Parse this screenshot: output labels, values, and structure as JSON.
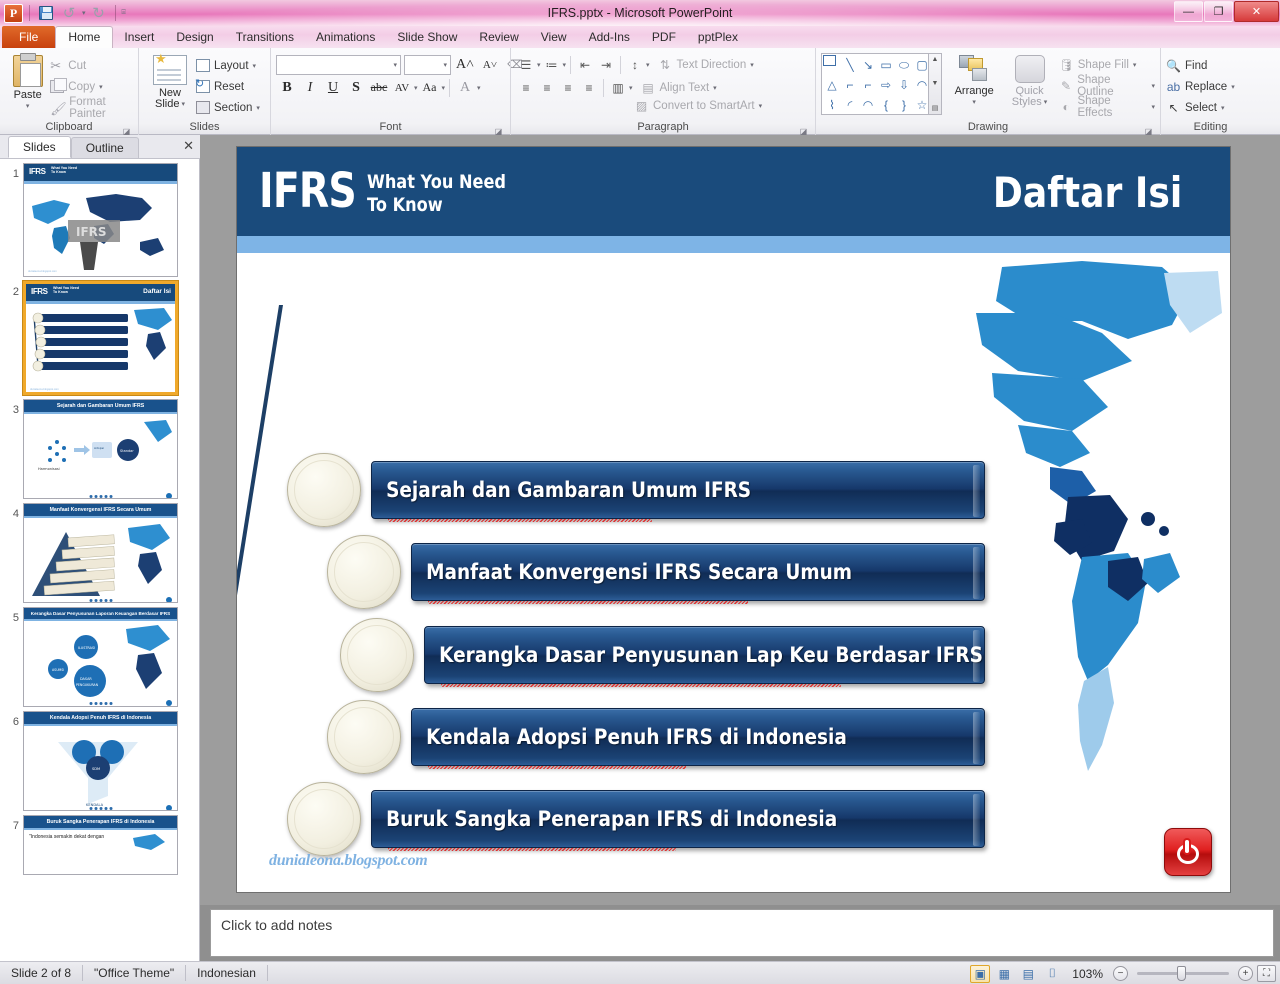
{
  "window": {
    "title": "IFRS.pptx  -  Microsoft PowerPoint",
    "app_icon": "powerpoint-icon",
    "minimize": "—",
    "maximize": "❐",
    "close": "✕"
  },
  "quick_access": [
    {
      "name": "save",
      "glyph": "save-icon"
    },
    {
      "name": "undo",
      "glyph": "↺"
    },
    {
      "name": "redo",
      "glyph": "↻"
    },
    {
      "name": "customize",
      "glyph": "▾"
    }
  ],
  "ribbon_tabs": [
    {
      "label": "File",
      "type": "file"
    },
    {
      "label": "Home",
      "type": "active"
    },
    {
      "label": "Insert",
      "type": "normal"
    },
    {
      "label": "Design",
      "type": "normal"
    },
    {
      "label": "Transitions",
      "type": "normal"
    },
    {
      "label": "Animations",
      "type": "normal"
    },
    {
      "label": "Slide Show",
      "type": "normal"
    },
    {
      "label": "Review",
      "type": "normal"
    },
    {
      "label": "View",
      "type": "normal"
    },
    {
      "label": "Add-Ins",
      "type": "normal"
    },
    {
      "label": "PDF",
      "type": "normal"
    },
    {
      "label": "pptPlex",
      "type": "normal"
    }
  ],
  "ribbon": {
    "clipboard": {
      "label": "Clipboard",
      "paste": "Paste",
      "cut": "Cut",
      "copy": "Copy",
      "format_painter": "Format Painter"
    },
    "slides": {
      "label": "Slides",
      "new_slide": "New\nSlide",
      "new_slide_line1": "New",
      "new_slide_line2": "Slide",
      "layout": "Layout",
      "reset": "Reset",
      "section": "Section"
    },
    "font": {
      "label": "Font",
      "font_name": "",
      "font_size": "",
      "bold": "B",
      "italic": "I",
      "underline": "U",
      "shadow": "S",
      "strikethrough": "abc",
      "spacing": "AV",
      "change_case": "Aa",
      "font_color": "A",
      "clear_formatting": "clear-formatting-icon"
    },
    "paragraph": {
      "label": "Paragraph",
      "text_direction": "Text Direction",
      "align_text": "Align Text",
      "convert_smartart": "Convert to SmartArt"
    },
    "drawing": {
      "label": "Drawing",
      "arrange": "Arrange",
      "quick_styles_line1": "Quick",
      "quick_styles_line2": "Styles",
      "shape_fill": "Shape Fill",
      "shape_outline": "Shape Outline",
      "shape_effects": "Shape Effects",
      "shapes": [
        "▤",
        "╲",
        "↘",
        "▭",
        "⬭",
        "▢",
        "△",
        "⌐",
        "⌐",
        "⇨",
        "⇩",
        "◠",
        "⌇",
        "◡",
        "◠",
        "{",
        "}",
        "☆"
      ]
    },
    "editing": {
      "label": "Editing",
      "find": "Find",
      "replace": "Replace",
      "select": "Select"
    }
  },
  "panel": {
    "tab_slides": "Slides",
    "tab_outline": "Outline",
    "close": "✕",
    "thumbnails": [
      {
        "number": "1",
        "type": "title",
        "title": "",
        "selected": false
      },
      {
        "number": "2",
        "type": "toc",
        "title": "Daftar Isi",
        "selected": true
      },
      {
        "number": "3",
        "type": "content",
        "title": "Sejarah dan Gambaran Umum IFRS",
        "selected": false
      },
      {
        "number": "4",
        "type": "content",
        "title": "Manfaat Konvergensi IFRS Secara Umum",
        "selected": false
      },
      {
        "number": "5",
        "type": "content",
        "title": "Kerangka Dasar Penyusunan Laporan Keuangan Berdasar IFRS",
        "selected": false
      },
      {
        "number": "6",
        "type": "content",
        "title": "Kendala Adopsi Penuh IFRS di Indonesia",
        "selected": false
      },
      {
        "number": "7",
        "type": "content",
        "title": "Buruk Sangka Penerapan IFRS di Indonesia",
        "selected": false,
        "body": "\"Indonesia semakin dekat dengan"
      }
    ]
  },
  "slide": {
    "brand": "IFRS",
    "brand_sub_line1": "What You Need",
    "brand_sub_line2": "To Know",
    "title": "Daftar Isi",
    "items": [
      {
        "text": "Sejarah dan Gambaran Umum IFRS",
        "misspelled_width": 210
      },
      {
        "text": "Manfaat Konvergensi IFRS Secara Umum",
        "misspelled_width": 255
      },
      {
        "text": "Kerangka Dasar  Penyusunan Lap Keu Berdasar IFRS",
        "misspelled_width": 330
      },
      {
        "text": "Kendala Adopsi  Penuh IFRS di Indonesia",
        "misspelled_width": 200
      },
      {
        "text": "Buruk Sangka Penerapan IFRS di Indonesia",
        "misspelled_width": 228
      }
    ],
    "footer": "dunialeona.blogspot.com",
    "power_icon": "power-button-icon"
  },
  "notes": {
    "placeholder": "Click to add notes"
  },
  "status": {
    "slide_counter": "Slide 2 of 8",
    "theme": "\"Office Theme\"",
    "language": "Indonesian",
    "zoom": "103%",
    "views": [
      {
        "name": "normal-view",
        "glyph": "▣",
        "selected": true
      },
      {
        "name": "slide-sorter-view",
        "glyph": "▦",
        "selected": false
      },
      {
        "name": "reading-view",
        "glyph": "▤",
        "selected": false
      },
      {
        "name": "slide-show-view",
        "glyph": "⌷",
        "selected": false
      }
    ],
    "zoom_out": "−",
    "zoom_in": "+",
    "fit_window": "⛶"
  },
  "colors": {
    "header_blue": "#1a4b7c",
    "light_blue_bar": "#7eb4e6",
    "bar_dark": "#16386a",
    "circle_cream": "#f5f2e4",
    "accent_red": "#e02020",
    "footer_blue": "#7fb2e2"
  }
}
